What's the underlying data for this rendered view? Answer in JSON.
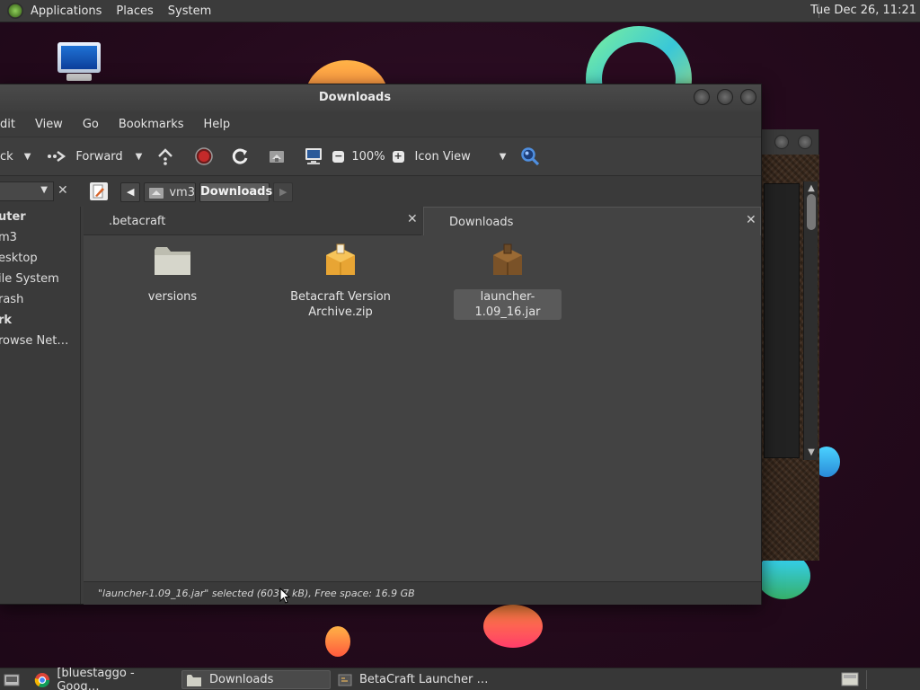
{
  "top_panel": {
    "menus": [
      "Applications",
      "Places",
      "System"
    ],
    "clock": "Tue Dec 26, 11:21"
  },
  "window": {
    "title": "Downloads",
    "menubar": [
      "dit",
      "View",
      "Go",
      "Bookmarks",
      "Help"
    ],
    "toolbar": {
      "back_label": "ck",
      "forward_label": "Forward",
      "zoom_value": "100%",
      "view_mode": "Icon View"
    },
    "breadcrumb": [
      "vm3",
      "Downloads"
    ],
    "sidebar": {
      "items": [
        {
          "label": "uter",
          "bold": true
        },
        {
          "label": "m3",
          "bold": false
        },
        {
          "label": "esktop",
          "bold": false
        },
        {
          "label": "ile System",
          "bold": false
        },
        {
          "label": "rash",
          "bold": false
        },
        {
          "label": "rk",
          "bold": true
        },
        {
          "label": "rowse Net…",
          "bold": false
        }
      ]
    },
    "tabs": [
      {
        "label": ".betacraft",
        "active": false
      },
      {
        "label": "Downloads",
        "active": true
      }
    ],
    "files": [
      {
        "name": "versions",
        "type": "folder-icon"
      },
      {
        "name": "Betacraft Version Archive.zip",
        "type": "archive-icon"
      },
      {
        "name": "launcher-1.09_16.jar",
        "type": "jar-icon",
        "selected": true
      }
    ],
    "status": "\"launcher-1.09_16.jar\" selected (603.7 kB), Free space: 16.9 GB"
  },
  "taskbar": {
    "tasks": [
      {
        "label": "[bluestaggo - Goog…",
        "icon": "chrome-icon"
      },
      {
        "label": "Downloads",
        "icon": "folder-icon",
        "active": true
      },
      {
        "label": "BetaCraft Launcher …",
        "icon": "java-icon"
      }
    ]
  },
  "colors": {
    "window_bg": "#3c3c3c",
    "content_bg": "#434343",
    "desktop_bg": "#2a0a1f"
  }
}
